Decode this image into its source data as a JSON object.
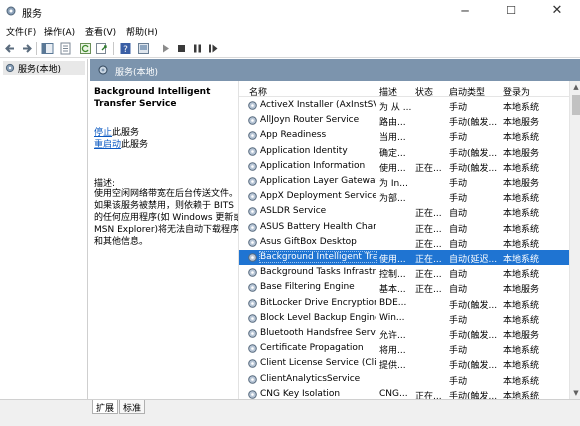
{
  "window": {
    "title": "服务",
    "minimize_glyph": "─",
    "maximize_glyph": "☐",
    "close_glyph": "✕"
  },
  "menu": [
    "文件(F)",
    "操作(A)",
    "查看(V)",
    "帮助(H)"
  ],
  "toolbar": {
    "icons": [
      "back-arrow-icon",
      "forward-arrow-icon",
      "console-tree-icon",
      "properties-icon",
      "refresh-icon",
      "export-icon",
      "help-icon",
      "console-icon",
      "play-icon",
      "stop-icon",
      "pause-icon",
      "restart-icon"
    ]
  },
  "tree": {
    "root_label": "服务(本地)"
  },
  "header": {
    "label": "服务(本地)"
  },
  "details": {
    "title": "Background Intelligent Transfer Service",
    "stop_link": "停止",
    "stop_suffix": "此服务",
    "restart_link": "重启动",
    "restart_suffix": "此服务",
    "desc_label": "描述:",
    "desc_text": "使用空闲网络带宽在后台传送文件。如果该服务被禁用，则依赖于 BITS 的任何应用程序(如 Windows 更新或 MSN Explorer)将无法自动下载程序和其他信息。"
  },
  "list": {
    "sort_glyph": "^",
    "columns": {
      "name": "名称",
      "desc": "描述",
      "status": "状态",
      "start": "启动类型",
      "logon": "登录为"
    },
    "rows": [
      {
        "name": "ActiveX Installer (AxInstSV)",
        "desc": "为 从 ...",
        "status": "",
        "start": "手动",
        "logon": "本地系统"
      },
      {
        "name": "AllJoyn Router Service",
        "desc": "路由...",
        "status": "",
        "start": "手动(触发...",
        "logon": "本地服务"
      },
      {
        "name": "App Readiness",
        "desc": "当用...",
        "status": "",
        "start": "手动",
        "logon": "本地系统"
      },
      {
        "name": "Application Identity",
        "desc": "确定...",
        "status": "",
        "start": "手动(触发...",
        "logon": "本地服务"
      },
      {
        "name": "Application Information",
        "desc": "使用...",
        "status": "正在...",
        "start": "手动(触发...",
        "logon": "本地系统"
      },
      {
        "name": "Application Layer Gateway ...",
        "desc": "为 In...",
        "status": "",
        "start": "手动",
        "logon": "本地服务"
      },
      {
        "name": "AppX Deployment Service ...",
        "desc": "为部...",
        "status": "",
        "start": "手动",
        "logon": "本地系统"
      },
      {
        "name": "ASLDR Service",
        "desc": "",
        "status": "正在...",
        "start": "自动",
        "logon": "本地系统"
      },
      {
        "name": "ASUS Battery Health Charg...",
        "desc": "",
        "status": "正在...",
        "start": "自动",
        "logon": "本地系统"
      },
      {
        "name": "Asus GiftBox Desktop",
        "desc": "",
        "status": "正在...",
        "start": "自动",
        "logon": "本地系统"
      },
      {
        "name": "Background Intelligent Tra...",
        "desc": "使用...",
        "status": "正在...",
        "start": "自动(延迟...",
        "logon": "本地系统",
        "selected": true
      },
      {
        "name": "Background Tasks Infrastru...",
        "desc": "控制...",
        "status": "正在...",
        "start": "自动",
        "logon": "本地系统"
      },
      {
        "name": "Base Filtering Engine",
        "desc": "基本...",
        "status": "正在...",
        "start": "自动",
        "logon": "本地服务"
      },
      {
        "name": "BitLocker Drive Encryption ...",
        "desc": "BDE...",
        "status": "",
        "start": "手动(触发...",
        "logon": "本地系统"
      },
      {
        "name": "Block Level Backup Engine ...",
        "desc": "Win...",
        "status": "",
        "start": "手动",
        "logon": "本地系统"
      },
      {
        "name": "Bluetooth Handsfree Service",
        "desc": "允许...",
        "status": "",
        "start": "手动(触发...",
        "logon": "本地服务"
      },
      {
        "name": "Certificate Propagation",
        "desc": "将用...",
        "status": "",
        "start": "手动",
        "logon": "本地系统"
      },
      {
        "name": "Client License Service (Clip...",
        "desc": "提供...",
        "status": "",
        "start": "手动(触发...",
        "logon": "本地系统"
      },
      {
        "name": "ClientAnalyticsService",
        "desc": "",
        "status": "",
        "start": "手动",
        "logon": "本地系统"
      },
      {
        "name": "CNG Key Isolation",
        "desc": "CNG...",
        "status": "正在...",
        "start": "手动(触发...",
        "logon": "本地系统"
      }
    ]
  },
  "tabs": {
    "extended": "扩展",
    "standard": "标准"
  },
  "colors": {
    "header_bg": "#7c94ad",
    "selection": "#1f74d2",
    "link": "#0a58c2"
  }
}
